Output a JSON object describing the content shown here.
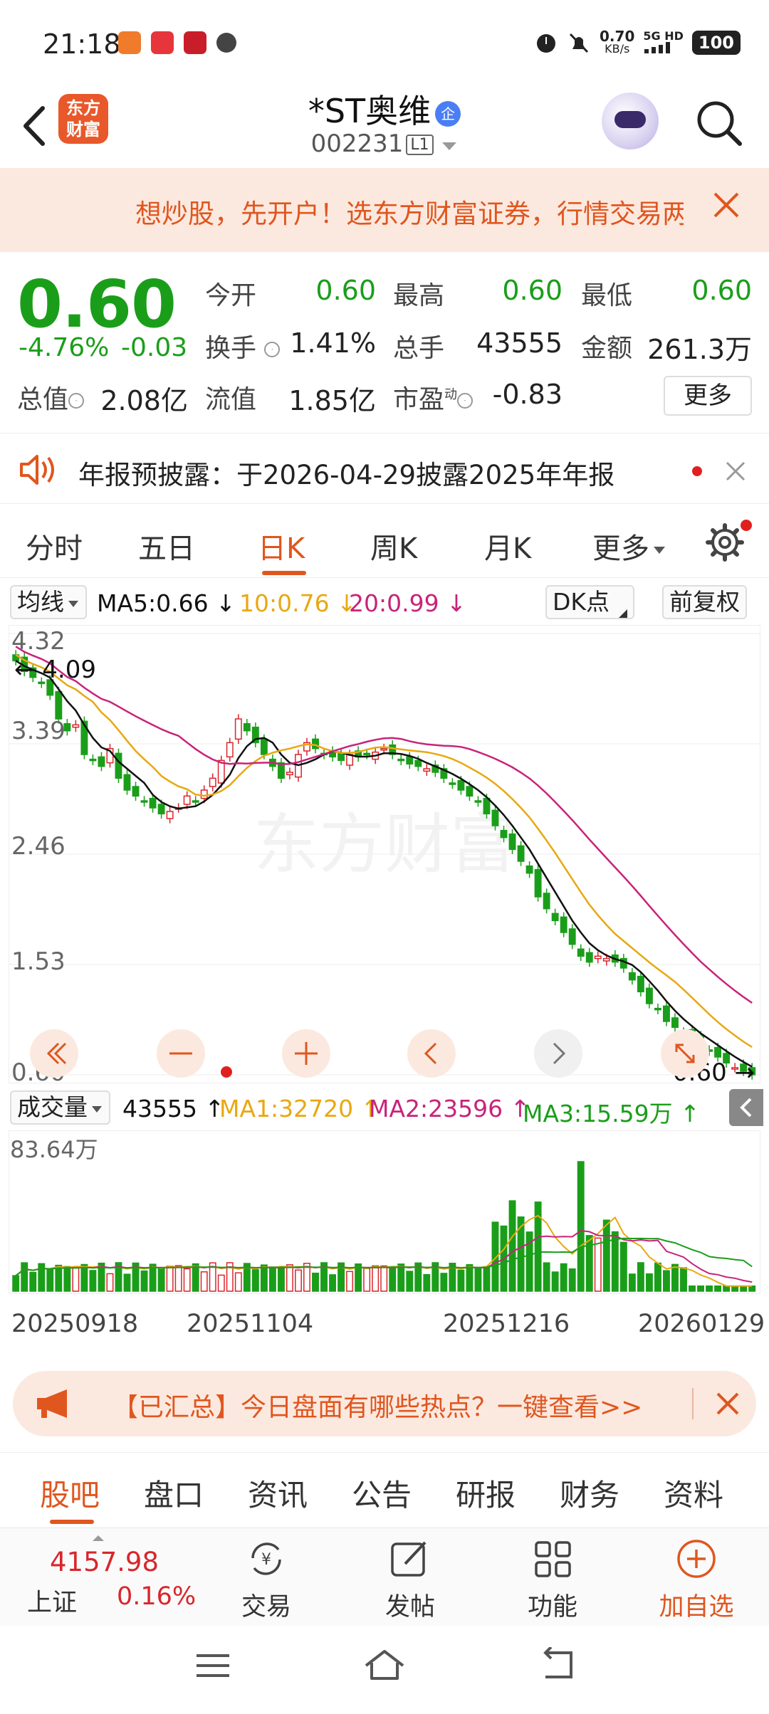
{
  "status_bar": {
    "time": "21:18",
    "speed": "0.70",
    "speed_unit": "KB/s",
    "network": "5G HD",
    "battery": "100"
  },
  "header": {
    "logo_text_1": "东方",
    "logo_text_2": "财富",
    "title": "*ST奥维",
    "enterprise_badge": "企",
    "code": "002231",
    "level": "L1"
  },
  "promo": {
    "text": "想炒股，先开户！选东方财富证券，行情交易两不误"
  },
  "quote": {
    "price": "0.60",
    "change_pct": "-4.76%",
    "change": "-0.03",
    "fields": [
      {
        "label": "今开",
        "value": "0.60"
      },
      {
        "label": "最高",
        "value": "0.60"
      },
      {
        "label": "最低",
        "value": "0.60"
      },
      {
        "label": "换手",
        "value": "1.41%"
      },
      {
        "label": "总手",
        "value": "43555"
      },
      {
        "label": "金额",
        "value": "261.3万"
      },
      {
        "label": "总值",
        "value": "2.08亿"
      },
      {
        "label": "流值",
        "value": "1.85亿"
      },
      {
        "label": "市盈",
        "value": "-0.83"
      }
    ],
    "pe_superscript": "动",
    "more_label": "更多"
  },
  "notice": {
    "text": "年报预披露：于2026-04-29披露2025年年报"
  },
  "chart_tabs": [
    "分时",
    "五日",
    "日K",
    "周K",
    "月K",
    "更多"
  ],
  "chart_tabs_active": "日K",
  "ma_bar": {
    "indicator": "均线",
    "ma5": "MA5:0.66 ↓",
    "ma10": "10:0.76 ↓",
    "ma20": "20:0.99 ↓",
    "dk_label": "DK点",
    "adjust_label": "前复权"
  },
  "colors": {
    "up": "#d8262c",
    "down": "#1a9e1a",
    "accent": "#e0561f",
    "ma5": "#111111",
    "ma10": "#e8a812",
    "ma20": "#c8237a"
  },
  "kline_labels": {
    "y_top": "4.32",
    "y_2": "3.39",
    "y_3": "2.46",
    "y_4": "1.53",
    "y_bottom": "0.60",
    "max_marker": "← 4.09",
    "min_marker": "0.60 →",
    "watermark": "东方财富"
  },
  "volume_bar": {
    "indicator": "成交量",
    "vol": "43555 ↑",
    "ma1": "MA1:32720 ↑",
    "ma2": "MA2:23596 ↑",
    "ma3": "MA3:15.59万 ↑",
    "y_top": "83.64万"
  },
  "dates": [
    "20250918",
    "20251104",
    "20251216",
    "20260129"
  ],
  "chart_data": {
    "type": "candlestick",
    "ylim": [
      0.6,
      4.32
    ],
    "closes": [
      4.09,
      4.0,
      3.95,
      3.9,
      3.8,
      3.6,
      3.5,
      3.55,
      3.3,
      3.25,
      3.2,
      3.35,
      3.1,
      3.0,
      2.95,
      2.9,
      2.85,
      2.8,
      2.82,
      2.85,
      2.95,
      2.9,
      3.0,
      3.1,
      3.25,
      3.4,
      3.6,
      3.5,
      3.4,
      3.3,
      3.2,
      3.1,
      3.15,
      3.3,
      3.4,
      3.35,
      3.3,
      3.28,
      3.25,
      3.3,
      3.28,
      3.3,
      3.32,
      3.35,
      3.3,
      3.25,
      3.22,
      3.2,
      3.18,
      3.15,
      3.1,
      3.05,
      3.0,
      2.95,
      2.9,
      2.8,
      2.7,
      2.6,
      2.5,
      2.4,
      2.3,
      2.1,
      2.0,
      1.9,
      1.8,
      1.7,
      1.6,
      1.55,
      1.6,
      1.58,
      1.55,
      1.5,
      1.4,
      1.3,
      1.2,
      1.15,
      1.05,
      1.0,
      0.95,
      0.9,
      0.85,
      0.8,
      0.75,
      0.7,
      0.66,
      0.63,
      0.6
    ],
    "volume_max": "83.64万"
  },
  "hot_banner": {
    "text": "【已汇总】今日盘面有哪些热点？一键查看>>"
  },
  "section_tabs": [
    "股吧",
    "盘口",
    "资讯",
    "公告",
    "研报",
    "财务",
    "资料"
  ],
  "toolbar": {
    "index_value": "4157.98",
    "index_name": "上证",
    "index_change": "0.16%",
    "items": [
      "交易",
      "发帖",
      "功能",
      "加自选"
    ]
  }
}
